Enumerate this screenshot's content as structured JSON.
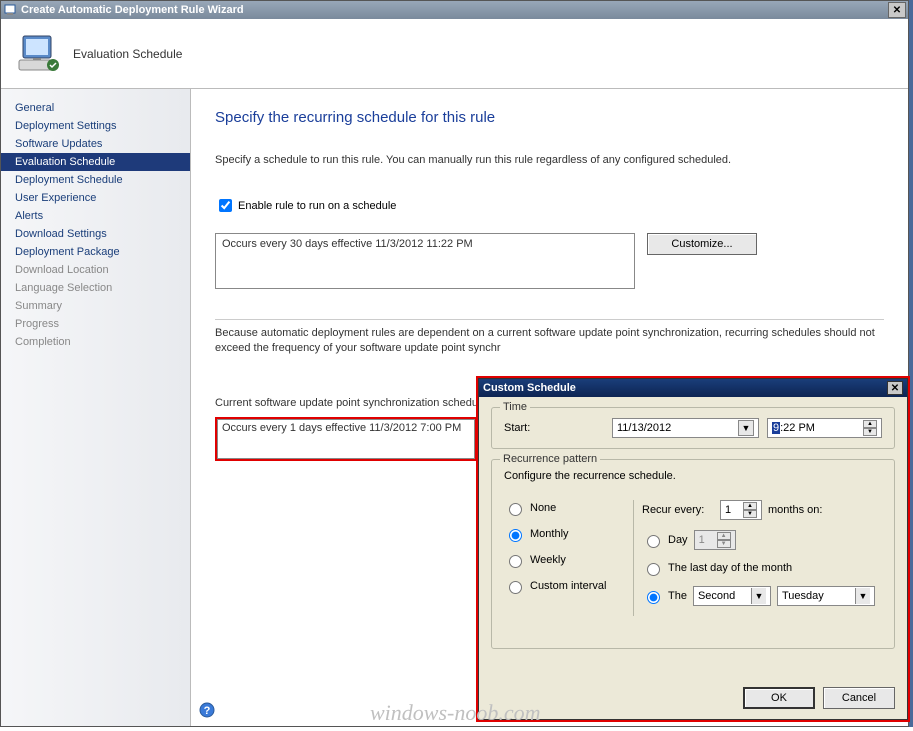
{
  "window": {
    "title": "Create Automatic Deployment Rule Wizard",
    "header_title": "Evaluation Schedule"
  },
  "sidebar": {
    "items": [
      {
        "label": "General",
        "state": "normal"
      },
      {
        "label": "Deployment Settings",
        "state": "normal"
      },
      {
        "label": "Software Updates",
        "state": "normal"
      },
      {
        "label": "Evaluation Schedule",
        "state": "selected"
      },
      {
        "label": "Deployment Schedule",
        "state": "normal"
      },
      {
        "label": "User Experience",
        "state": "normal"
      },
      {
        "label": "Alerts",
        "state": "normal"
      },
      {
        "label": "Download Settings",
        "state": "normal"
      },
      {
        "label": "Deployment Package",
        "state": "normal"
      },
      {
        "label": "Download Location",
        "state": "disabled"
      },
      {
        "label": "Language Selection",
        "state": "disabled"
      },
      {
        "label": "Summary",
        "state": "disabled"
      },
      {
        "label": "Progress",
        "state": "disabled"
      },
      {
        "label": "Completion",
        "state": "disabled"
      }
    ]
  },
  "content": {
    "page_title": "Specify the recurring schedule for this rule",
    "instruction": "Specify a schedule to run this rule. You can manually run this rule regardless of any configured scheduled.",
    "enable_label": "Enable rule to run on a schedule",
    "schedule_text": "Occurs every 30 days effective 11/3/2012 11:22 PM",
    "customize_label": "Customize...",
    "info_text": "Because automatic deployment rules are dependent on a current software update point synchronization, recurring schedules should not exceed the frequency of your software update point synchr",
    "sync_label": "Current software update point synchronization schedule:",
    "sync_text": "Occurs every 1 days effective 11/3/2012 7:00 PM"
  },
  "dialog": {
    "title": "Custom Schedule",
    "time_group": "Time",
    "start_label": "Start:",
    "start_date": "11/13/2012",
    "start_time_prefix": "9",
    "start_time_rest": ":22 PM",
    "recur_group": "Recurrence pattern",
    "recur_instruction": "Configure the recurrence schedule.",
    "opt_none": "None",
    "opt_monthly": "Monthly",
    "opt_weekly": "Weekly",
    "opt_custom": "Custom interval",
    "recur_every": "Recur every:",
    "recur_value": "1",
    "recur_unit": "months on:",
    "opt_day": "Day",
    "day_value": "1",
    "opt_last": "The last day of the month",
    "opt_the": "The",
    "ordinal": "Second",
    "weekday": "Tuesday",
    "ok": "OK",
    "cancel": "Cancel"
  },
  "watermark": "windows-noob.com"
}
